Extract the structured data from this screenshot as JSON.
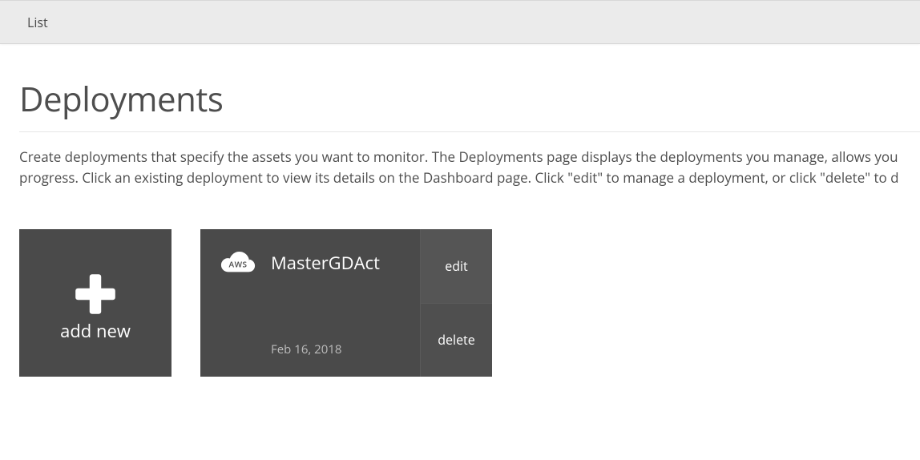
{
  "topbar": {
    "item": "List"
  },
  "page": {
    "title": "Deployments",
    "description": "Create deployments that specify the assets you want to monitor. The Deployments page displays the deployments you manage, allows you progress. Click an existing deployment to view its details on the Dashboard page. Click \"edit\" to manage a deployment, or click \"delete\" to d"
  },
  "addCard": {
    "label": "add new"
  },
  "deployment": {
    "provider": "AWS",
    "name": "MasterGDAct",
    "date": "Feb 16, 2018",
    "editLabel": "edit",
    "deleteLabel": "delete"
  }
}
